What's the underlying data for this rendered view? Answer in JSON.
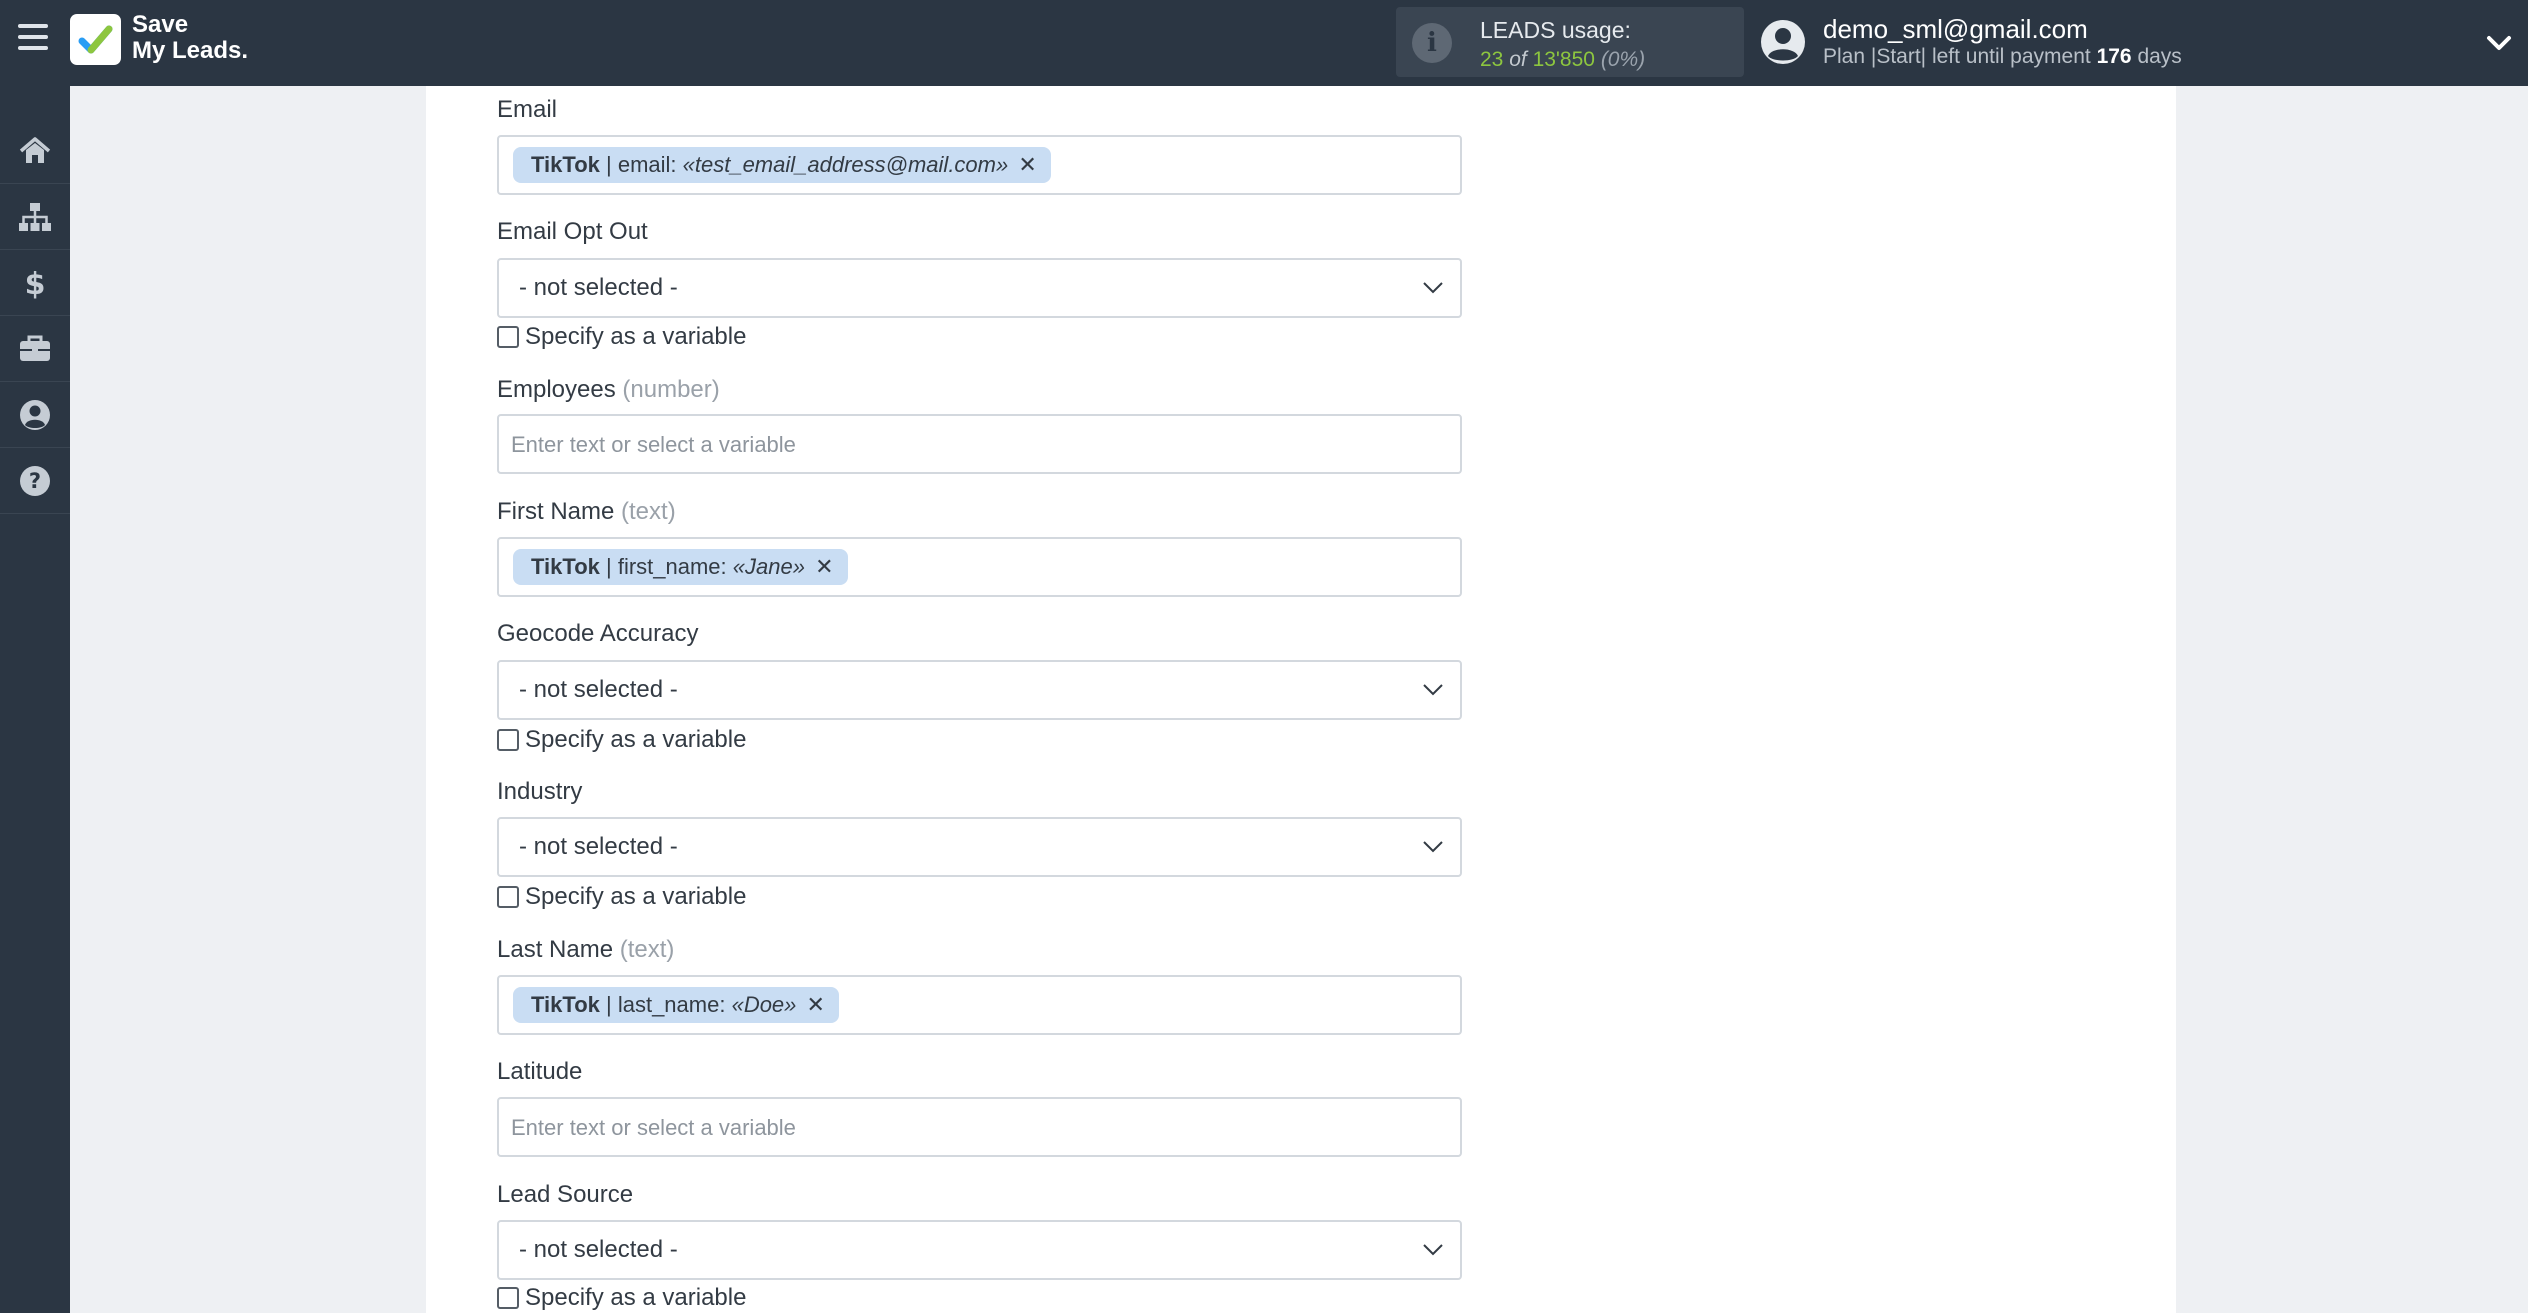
{
  "app": {
    "name_line1": "Save",
    "name_line2": "My Leads."
  },
  "usage": {
    "title": "LEADS usage:",
    "used": "23",
    "of": "of",
    "total": "13'850",
    "percent": "(0%)"
  },
  "user": {
    "email": "demo_sml@gmail.com",
    "plan_text": "Plan |Start| left until payment",
    "days": "176",
    "days_unit": "days"
  },
  "sidebar": [
    {
      "name": "home-icon"
    },
    {
      "name": "sitemap-icon"
    },
    {
      "name": "dollar-icon"
    },
    {
      "name": "briefcase-icon"
    },
    {
      "name": "user-circle-icon"
    },
    {
      "name": "help-icon"
    }
  ],
  "specify_label": "Specify as a variable",
  "not_selected": "- not selected -",
  "placeholder": "Enter text or select a variable",
  "fields": {
    "email": {
      "label": "Email",
      "tag": {
        "source": "TikTok",
        "field": "| email:",
        "value": "«test_email_address@mail.com»"
      }
    },
    "email_opt_out": {
      "label": "Email Opt Out"
    },
    "employees": {
      "label": "Employees",
      "hint": "(number)"
    },
    "first_name": {
      "label": "First Name",
      "hint": "(text)",
      "tag": {
        "source": "TikTok",
        "field": "| first_name:",
        "value": "«Jane»"
      }
    },
    "geocode_accuracy": {
      "label": "Geocode Accuracy"
    },
    "industry": {
      "label": "Industry"
    },
    "last_name": {
      "label": "Last Name",
      "hint": "(text)",
      "tag": {
        "source": "TikTok",
        "field": "| last_name:",
        "value": "«Doe»"
      }
    },
    "latitude": {
      "label": "Latitude"
    },
    "lead_source": {
      "label": "Lead Source"
    }
  },
  "colors": {
    "topbar": "#2b3643",
    "accent_green": "#8dc63f",
    "tag_bg": "#c9ddf3"
  }
}
